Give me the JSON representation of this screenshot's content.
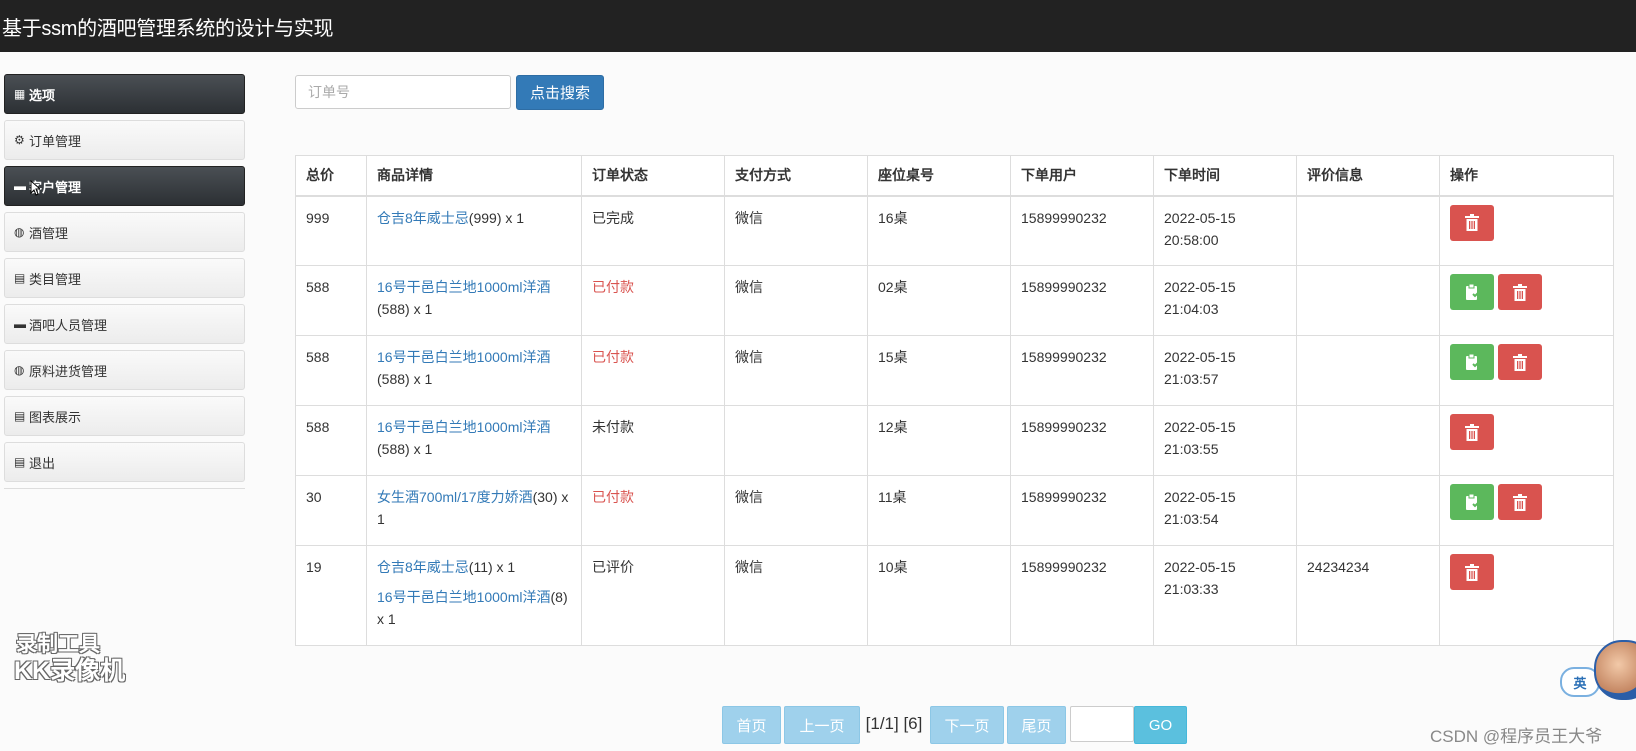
{
  "header": {
    "title": "基于ssm的酒吧管理系统的设计与实现"
  },
  "sidebar": {
    "items": [
      {
        "label": "选项",
        "icon": "grid-icon",
        "glyph": "▦",
        "dark": true
      },
      {
        "label": "订单管理",
        "icon": "gear-icon",
        "glyph": "⚙",
        "dark": false
      },
      {
        "label": "客户管理",
        "icon": "card-icon",
        "glyph": "▬",
        "dark": true
      },
      {
        "label": "酒管理",
        "icon": "globe-icon",
        "glyph": "◍",
        "dark": false
      },
      {
        "label": "类目管理",
        "icon": "calendar-icon",
        "glyph": "▤",
        "dark": false
      },
      {
        "label": "酒吧人员管理",
        "icon": "card-icon",
        "glyph": "▬",
        "dark": false
      },
      {
        "label": "原料进货管理",
        "icon": "globe-icon",
        "glyph": "◍",
        "dark": false
      },
      {
        "label": "图表展示",
        "icon": "calendar-icon",
        "glyph": "▤",
        "dark": false
      },
      {
        "label": "退出",
        "icon": "calendar-icon",
        "glyph": "▤",
        "dark": false
      }
    ]
  },
  "search": {
    "placeholder": "订单号",
    "button_label": "点击搜索"
  },
  "table": {
    "headers": [
      "总价",
      "商品详情",
      "订单状态",
      "支付方式",
      "座位桌号",
      "下单用户",
      "下单时间",
      "评价信息",
      "操作"
    ],
    "rows": [
      {
        "total": "999",
        "items": [
          {
            "name": "仓吉8年威士忌",
            "suffix": "(999) x 1"
          }
        ],
        "status": "已完成",
        "status_type": "normal",
        "pay": "微信",
        "seat": "16桌",
        "user": "15899990232",
        "date": "2022-05-15",
        "time": "20:58:00",
        "review": "",
        "actions": [
          "delete"
        ]
      },
      {
        "total": "588",
        "items": [
          {
            "name": "16号干邑白兰地1000ml洋酒",
            "suffix": "(588) x 1"
          }
        ],
        "status": "已付款",
        "status_type": "paid",
        "pay": "微信",
        "seat": "02桌",
        "user": "15899990232",
        "date": "2022-05-15",
        "time": "21:04:03",
        "review": "",
        "actions": [
          "confirm",
          "delete"
        ]
      },
      {
        "total": "588",
        "items": [
          {
            "name": "16号干邑白兰地1000ml洋酒",
            "suffix": "(588) x 1"
          }
        ],
        "status": "已付款",
        "status_type": "paid",
        "pay": "微信",
        "seat": "15桌",
        "user": "15899990232",
        "date": "2022-05-15",
        "time": "21:03:57",
        "review": "",
        "actions": [
          "confirm",
          "delete"
        ]
      },
      {
        "total": "588",
        "items": [
          {
            "name": "16号干邑白兰地1000ml洋酒",
            "suffix": "(588) x 1"
          }
        ],
        "status": "未付款",
        "status_type": "normal",
        "pay": "",
        "seat": "12桌",
        "user": "15899990232",
        "date": "2022-05-15",
        "time": "21:03:55",
        "review": "",
        "actions": [
          "delete"
        ]
      },
      {
        "total": "30",
        "items": [
          {
            "name": "女生酒700ml/17度力娇酒",
            "suffix": "(30) x 1"
          }
        ],
        "status": "已付款",
        "status_type": "paid",
        "pay": "微信",
        "seat": "11桌",
        "user": "15899990232",
        "date": "2022-05-15",
        "time": "21:03:54",
        "review": "",
        "actions": [
          "confirm",
          "delete"
        ]
      },
      {
        "total": "19",
        "items": [
          {
            "name": "仓吉8年威士忌",
            "suffix": "(11) x 1"
          },
          {
            "name": "16号干邑白兰地1000ml洋酒",
            "suffix": "(8) x 1"
          }
        ],
        "status": "已评价",
        "status_type": "normal",
        "pay": "微信",
        "seat": "10桌",
        "user": "15899990232",
        "date": "2022-05-15",
        "time": "21:03:33",
        "review": "24234234",
        "actions": [
          "delete"
        ]
      }
    ]
  },
  "pagination": {
    "first": "首页",
    "prev": "上一页",
    "info": "[1/1] [6]",
    "next": "下一页",
    "last": "尾页",
    "go": "GO",
    "page_input": ""
  },
  "overlay": {
    "watermark_line1": "录制工具",
    "watermark_line2": "KK录像机",
    "csdn_credit": "CSDN @程序员王大爷",
    "ime_label": "英"
  },
  "colors": {
    "topbar": "#222222",
    "primary": "#337ab7",
    "danger": "#d9534f",
    "success": "#5cb85c",
    "paid_text": "#d9534f",
    "pager": "#9fd1ec",
    "go": "#5bc0de"
  }
}
